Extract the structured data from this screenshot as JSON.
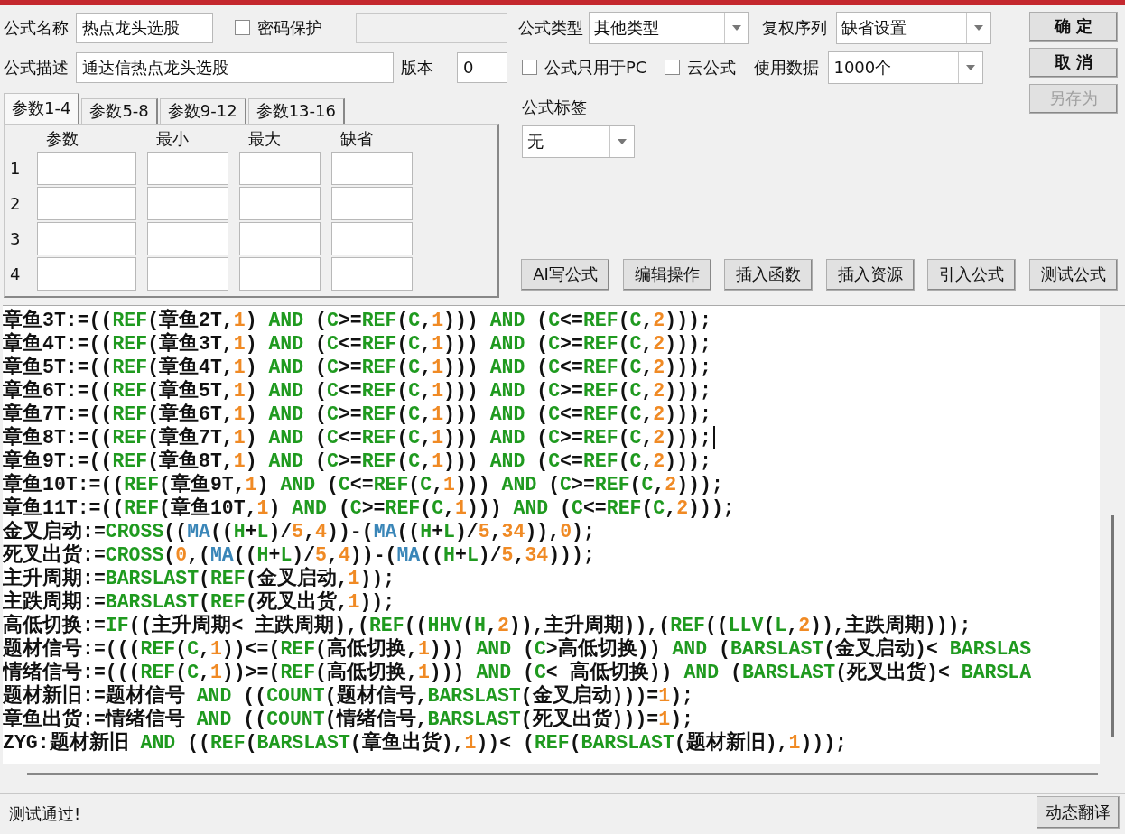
{
  "formula_name": {
    "label": "公式名称",
    "value": "热点龙头选股"
  },
  "password_protect": {
    "label": "密码保护",
    "checked": false
  },
  "password_field": {
    "disabled": true
  },
  "description": {
    "label": "公式描述",
    "value": "通达信热点龙头选股"
  },
  "version": {
    "label": "版本",
    "value": "0"
  },
  "param_tabs": [
    {
      "label": "参数1-4",
      "selected": true
    },
    {
      "label": "参数5-8",
      "selected": false
    },
    {
      "label": "参数9-12",
      "selected": false
    },
    {
      "label": "参数13-16",
      "selected": false
    }
  ],
  "param_table": {
    "columns": [
      "参数",
      "最小",
      "最大",
      "缺省"
    ],
    "rows": [
      "1",
      "2",
      "3",
      "4"
    ]
  },
  "formula_type": {
    "label": "公式类型",
    "value": "其他类型"
  },
  "adjust_series": {
    "label": "复权序列",
    "value": "缺省设置"
  },
  "pc_only": {
    "label": "公式只用于PC",
    "checked": false
  },
  "cloud": {
    "label": "云公式",
    "checked": false
  },
  "data_count": {
    "label": "使用数据",
    "value": "1000个"
  },
  "formula_tag": {
    "label": "公式标签",
    "value": "无"
  },
  "dialog_buttons": [
    {
      "label": "确 定",
      "disabled": false
    },
    {
      "label": "取 消",
      "disabled": false
    },
    {
      "label": "另存为",
      "disabled": true
    }
  ],
  "tool_buttons": [
    "AI写公式",
    "编辑操作",
    "插入函数",
    "插入资源",
    "引入公式",
    "测试公式"
  ],
  "code_lines": [
    {
      "cursor": false,
      "tokens": [
        {
          "kind": "text",
          "text": "章鱼3T:=(("
        },
        {
          "kind": "func",
          "text": "REF"
        },
        {
          "kind": "text",
          "text": "(章鱼2T,"
        },
        {
          "kind": "num",
          "text": "1"
        },
        {
          "kind": "text",
          "text": ") "
        },
        {
          "kind": "func",
          "text": "AND"
        },
        {
          "kind": "text",
          "text": " ("
        },
        {
          "kind": "func",
          "text": "C"
        },
        {
          "kind": "text",
          "text": ">="
        },
        {
          "kind": "func",
          "text": "REF"
        },
        {
          "kind": "text",
          "text": "("
        },
        {
          "kind": "func",
          "text": "C"
        },
        {
          "kind": "text",
          "text": ","
        },
        {
          "kind": "num",
          "text": "1"
        },
        {
          "kind": "text",
          "text": "))) "
        },
        {
          "kind": "func",
          "text": "AND"
        },
        {
          "kind": "text",
          "text": " ("
        },
        {
          "kind": "func",
          "text": "C"
        },
        {
          "kind": "text",
          "text": "<="
        },
        {
          "kind": "func",
          "text": "REF"
        },
        {
          "kind": "text",
          "text": "("
        },
        {
          "kind": "func",
          "text": "C"
        },
        {
          "kind": "text",
          "text": ","
        },
        {
          "kind": "num",
          "text": "2"
        },
        {
          "kind": "text",
          "text": ")));"
        }
      ]
    },
    {
      "cursor": false,
      "tokens": [
        {
          "kind": "text",
          "text": "章鱼4T:=(("
        },
        {
          "kind": "func",
          "text": "REF"
        },
        {
          "kind": "text",
          "text": "(章鱼3T,"
        },
        {
          "kind": "num",
          "text": "1"
        },
        {
          "kind": "text",
          "text": ") "
        },
        {
          "kind": "func",
          "text": "AND"
        },
        {
          "kind": "text",
          "text": " ("
        },
        {
          "kind": "func",
          "text": "C"
        },
        {
          "kind": "text",
          "text": "<="
        },
        {
          "kind": "func",
          "text": "REF"
        },
        {
          "kind": "text",
          "text": "("
        },
        {
          "kind": "func",
          "text": "C"
        },
        {
          "kind": "text",
          "text": ","
        },
        {
          "kind": "num",
          "text": "1"
        },
        {
          "kind": "text",
          "text": "))) "
        },
        {
          "kind": "func",
          "text": "AND"
        },
        {
          "kind": "text",
          "text": " ("
        },
        {
          "kind": "func",
          "text": "C"
        },
        {
          "kind": "text",
          "text": ">="
        },
        {
          "kind": "func",
          "text": "REF"
        },
        {
          "kind": "text",
          "text": "("
        },
        {
          "kind": "func",
          "text": "C"
        },
        {
          "kind": "text",
          "text": ","
        },
        {
          "kind": "num",
          "text": "2"
        },
        {
          "kind": "text",
          "text": ")));"
        }
      ]
    },
    {
      "cursor": false,
      "tokens": [
        {
          "kind": "text",
          "text": "章鱼5T:=(("
        },
        {
          "kind": "func",
          "text": "REF"
        },
        {
          "kind": "text",
          "text": "(章鱼4T,"
        },
        {
          "kind": "num",
          "text": "1"
        },
        {
          "kind": "text",
          "text": ") "
        },
        {
          "kind": "func",
          "text": "AND"
        },
        {
          "kind": "text",
          "text": " ("
        },
        {
          "kind": "func",
          "text": "C"
        },
        {
          "kind": "text",
          "text": ">="
        },
        {
          "kind": "func",
          "text": "REF"
        },
        {
          "kind": "text",
          "text": "("
        },
        {
          "kind": "func",
          "text": "C"
        },
        {
          "kind": "text",
          "text": ","
        },
        {
          "kind": "num",
          "text": "1"
        },
        {
          "kind": "text",
          "text": "))) "
        },
        {
          "kind": "func",
          "text": "AND"
        },
        {
          "kind": "text",
          "text": " ("
        },
        {
          "kind": "func",
          "text": "C"
        },
        {
          "kind": "text",
          "text": "<="
        },
        {
          "kind": "func",
          "text": "REF"
        },
        {
          "kind": "text",
          "text": "("
        },
        {
          "kind": "func",
          "text": "C"
        },
        {
          "kind": "text",
          "text": ","
        },
        {
          "kind": "num",
          "text": "2"
        },
        {
          "kind": "text",
          "text": ")));"
        }
      ]
    },
    {
      "cursor": false,
      "tokens": [
        {
          "kind": "text",
          "text": "章鱼6T:=(("
        },
        {
          "kind": "func",
          "text": "REF"
        },
        {
          "kind": "text",
          "text": "(章鱼5T,"
        },
        {
          "kind": "num",
          "text": "1"
        },
        {
          "kind": "text",
          "text": ") "
        },
        {
          "kind": "func",
          "text": "AND"
        },
        {
          "kind": "text",
          "text": " ("
        },
        {
          "kind": "func",
          "text": "C"
        },
        {
          "kind": "text",
          "text": "<="
        },
        {
          "kind": "func",
          "text": "REF"
        },
        {
          "kind": "text",
          "text": "("
        },
        {
          "kind": "func",
          "text": "C"
        },
        {
          "kind": "text",
          "text": ","
        },
        {
          "kind": "num",
          "text": "1"
        },
        {
          "kind": "text",
          "text": "))) "
        },
        {
          "kind": "func",
          "text": "AND"
        },
        {
          "kind": "text",
          "text": " ("
        },
        {
          "kind": "func",
          "text": "C"
        },
        {
          "kind": "text",
          "text": ">="
        },
        {
          "kind": "func",
          "text": "REF"
        },
        {
          "kind": "text",
          "text": "("
        },
        {
          "kind": "func",
          "text": "C"
        },
        {
          "kind": "text",
          "text": ","
        },
        {
          "kind": "num",
          "text": "2"
        },
        {
          "kind": "text",
          "text": ")));"
        }
      ]
    },
    {
      "cursor": false,
      "tokens": [
        {
          "kind": "text",
          "text": "章鱼7T:=(("
        },
        {
          "kind": "func",
          "text": "REF"
        },
        {
          "kind": "text",
          "text": "(章鱼6T,"
        },
        {
          "kind": "num",
          "text": "1"
        },
        {
          "kind": "text",
          "text": ") "
        },
        {
          "kind": "func",
          "text": "AND"
        },
        {
          "kind": "text",
          "text": " ("
        },
        {
          "kind": "func",
          "text": "C"
        },
        {
          "kind": "text",
          "text": ">="
        },
        {
          "kind": "func",
          "text": "REF"
        },
        {
          "kind": "text",
          "text": "("
        },
        {
          "kind": "func",
          "text": "C"
        },
        {
          "kind": "text",
          "text": ","
        },
        {
          "kind": "num",
          "text": "1"
        },
        {
          "kind": "text",
          "text": "))) "
        },
        {
          "kind": "func",
          "text": "AND"
        },
        {
          "kind": "text",
          "text": " ("
        },
        {
          "kind": "func",
          "text": "C"
        },
        {
          "kind": "text",
          "text": "<="
        },
        {
          "kind": "func",
          "text": "REF"
        },
        {
          "kind": "text",
          "text": "("
        },
        {
          "kind": "func",
          "text": "C"
        },
        {
          "kind": "text",
          "text": ","
        },
        {
          "kind": "num",
          "text": "2"
        },
        {
          "kind": "text",
          "text": ")));"
        }
      ]
    },
    {
      "cursor": true,
      "tokens": [
        {
          "kind": "text",
          "text": "章鱼8T:=(("
        },
        {
          "kind": "func",
          "text": "REF"
        },
        {
          "kind": "text",
          "text": "(章鱼7T,"
        },
        {
          "kind": "num",
          "text": "1"
        },
        {
          "kind": "text",
          "text": ") "
        },
        {
          "kind": "func",
          "text": "AND"
        },
        {
          "kind": "text",
          "text": " ("
        },
        {
          "kind": "func",
          "text": "C"
        },
        {
          "kind": "text",
          "text": "<="
        },
        {
          "kind": "func",
          "text": "REF"
        },
        {
          "kind": "text",
          "text": "("
        },
        {
          "kind": "func",
          "text": "C"
        },
        {
          "kind": "text",
          "text": ","
        },
        {
          "kind": "num",
          "text": "1"
        },
        {
          "kind": "text",
          "text": "))) "
        },
        {
          "kind": "func",
          "text": "AND"
        },
        {
          "kind": "text",
          "text": " ("
        },
        {
          "kind": "func",
          "text": "C"
        },
        {
          "kind": "text",
          "text": ">="
        },
        {
          "kind": "func",
          "text": "REF"
        },
        {
          "kind": "text",
          "text": "("
        },
        {
          "kind": "func",
          "text": "C"
        },
        {
          "kind": "text",
          "text": ","
        },
        {
          "kind": "num",
          "text": "2"
        },
        {
          "kind": "text",
          "text": ")));"
        }
      ]
    },
    {
      "cursor": false,
      "tokens": [
        {
          "kind": "text",
          "text": "章鱼9T:=(("
        },
        {
          "kind": "func",
          "text": "REF"
        },
        {
          "kind": "text",
          "text": "(章鱼8T,"
        },
        {
          "kind": "num",
          "text": "1"
        },
        {
          "kind": "text",
          "text": ") "
        },
        {
          "kind": "func",
          "text": "AND"
        },
        {
          "kind": "text",
          "text": " ("
        },
        {
          "kind": "func",
          "text": "C"
        },
        {
          "kind": "text",
          "text": ">="
        },
        {
          "kind": "func",
          "text": "REF"
        },
        {
          "kind": "text",
          "text": "("
        },
        {
          "kind": "func",
          "text": "C"
        },
        {
          "kind": "text",
          "text": ","
        },
        {
          "kind": "num",
          "text": "1"
        },
        {
          "kind": "text",
          "text": "))) "
        },
        {
          "kind": "func",
          "text": "AND"
        },
        {
          "kind": "text",
          "text": " ("
        },
        {
          "kind": "func",
          "text": "C"
        },
        {
          "kind": "text",
          "text": "<="
        },
        {
          "kind": "func",
          "text": "REF"
        },
        {
          "kind": "text",
          "text": "("
        },
        {
          "kind": "func",
          "text": "C"
        },
        {
          "kind": "text",
          "text": ","
        },
        {
          "kind": "num",
          "text": "2"
        },
        {
          "kind": "text",
          "text": ")));"
        }
      ]
    },
    {
      "cursor": false,
      "tokens": [
        {
          "kind": "text",
          "text": "章鱼10T:=(("
        },
        {
          "kind": "func",
          "text": "REF"
        },
        {
          "kind": "text",
          "text": "(章鱼9T,"
        },
        {
          "kind": "num",
          "text": "1"
        },
        {
          "kind": "text",
          "text": ") "
        },
        {
          "kind": "func",
          "text": "AND"
        },
        {
          "kind": "text",
          "text": " ("
        },
        {
          "kind": "func",
          "text": "C"
        },
        {
          "kind": "text",
          "text": "<="
        },
        {
          "kind": "func",
          "text": "REF"
        },
        {
          "kind": "text",
          "text": "("
        },
        {
          "kind": "func",
          "text": "C"
        },
        {
          "kind": "text",
          "text": ","
        },
        {
          "kind": "num",
          "text": "1"
        },
        {
          "kind": "text",
          "text": "))) "
        },
        {
          "kind": "func",
          "text": "AND"
        },
        {
          "kind": "text",
          "text": " ("
        },
        {
          "kind": "func",
          "text": "C"
        },
        {
          "kind": "text",
          "text": ">="
        },
        {
          "kind": "func",
          "text": "REF"
        },
        {
          "kind": "text",
          "text": "("
        },
        {
          "kind": "func",
          "text": "C"
        },
        {
          "kind": "text",
          "text": ","
        },
        {
          "kind": "num",
          "text": "2"
        },
        {
          "kind": "text",
          "text": ")));"
        }
      ]
    },
    {
      "cursor": false,
      "tokens": [
        {
          "kind": "text",
          "text": "章鱼11T:=(("
        },
        {
          "kind": "func",
          "text": "REF"
        },
        {
          "kind": "text",
          "text": "(章鱼10T,"
        },
        {
          "kind": "num",
          "text": "1"
        },
        {
          "kind": "text",
          "text": ") "
        },
        {
          "kind": "func",
          "text": "AND"
        },
        {
          "kind": "text",
          "text": " ("
        },
        {
          "kind": "func",
          "text": "C"
        },
        {
          "kind": "text",
          "text": ">="
        },
        {
          "kind": "func",
          "text": "REF"
        },
        {
          "kind": "text",
          "text": "("
        },
        {
          "kind": "func",
          "text": "C"
        },
        {
          "kind": "text",
          "text": ","
        },
        {
          "kind": "num",
          "text": "1"
        },
        {
          "kind": "text",
          "text": "))) "
        },
        {
          "kind": "func",
          "text": "AND"
        },
        {
          "kind": "text",
          "text": " ("
        },
        {
          "kind": "func",
          "text": "C"
        },
        {
          "kind": "text",
          "text": "<="
        },
        {
          "kind": "func",
          "text": "REF"
        },
        {
          "kind": "text",
          "text": "("
        },
        {
          "kind": "func",
          "text": "C"
        },
        {
          "kind": "text",
          "text": ","
        },
        {
          "kind": "num",
          "text": "2"
        },
        {
          "kind": "text",
          "text": ")));"
        }
      ]
    },
    {
      "cursor": false,
      "tokens": [
        {
          "kind": "text",
          "text": "金叉启动:="
        },
        {
          "kind": "func",
          "text": "CROSS"
        },
        {
          "kind": "text",
          "text": "(("
        },
        {
          "kind": "indicator",
          "text": "MA"
        },
        {
          "kind": "text",
          "text": "(("
        },
        {
          "kind": "func",
          "text": "H"
        },
        {
          "kind": "text",
          "text": "+"
        },
        {
          "kind": "func",
          "text": "L"
        },
        {
          "kind": "text",
          "text": ")/"
        },
        {
          "kind": "num",
          "text": "5"
        },
        {
          "kind": "text",
          "text": ","
        },
        {
          "kind": "num",
          "text": "4"
        },
        {
          "kind": "text",
          "text": "))-("
        },
        {
          "kind": "indicator",
          "text": "MA"
        },
        {
          "kind": "text",
          "text": "(("
        },
        {
          "kind": "func",
          "text": "H"
        },
        {
          "kind": "text",
          "text": "+"
        },
        {
          "kind": "func",
          "text": "L"
        },
        {
          "kind": "text",
          "text": ")/"
        },
        {
          "kind": "num",
          "text": "5"
        },
        {
          "kind": "text",
          "text": ","
        },
        {
          "kind": "num",
          "text": "34"
        },
        {
          "kind": "text",
          "text": ")),"
        },
        {
          "kind": "num",
          "text": "0"
        },
        {
          "kind": "text",
          "text": ");"
        }
      ]
    },
    {
      "cursor": false,
      "tokens": [
        {
          "kind": "text",
          "text": "死叉出货:="
        },
        {
          "kind": "func",
          "text": "CROSS"
        },
        {
          "kind": "text",
          "text": "("
        },
        {
          "kind": "num",
          "text": "0"
        },
        {
          "kind": "text",
          "text": ",("
        },
        {
          "kind": "indicator",
          "text": "MA"
        },
        {
          "kind": "text",
          "text": "(("
        },
        {
          "kind": "func",
          "text": "H"
        },
        {
          "kind": "text",
          "text": "+"
        },
        {
          "kind": "func",
          "text": "L"
        },
        {
          "kind": "text",
          "text": ")/"
        },
        {
          "kind": "num",
          "text": "5"
        },
        {
          "kind": "text",
          "text": ","
        },
        {
          "kind": "num",
          "text": "4"
        },
        {
          "kind": "text",
          "text": "))-("
        },
        {
          "kind": "indicator",
          "text": "MA"
        },
        {
          "kind": "text",
          "text": "(("
        },
        {
          "kind": "func",
          "text": "H"
        },
        {
          "kind": "text",
          "text": "+"
        },
        {
          "kind": "func",
          "text": "L"
        },
        {
          "kind": "text",
          "text": ")/"
        },
        {
          "kind": "num",
          "text": "5"
        },
        {
          "kind": "text",
          "text": ","
        },
        {
          "kind": "num",
          "text": "34"
        },
        {
          "kind": "text",
          "text": ")));"
        }
      ]
    },
    {
      "cursor": false,
      "tokens": [
        {
          "kind": "text",
          "text": "主升周期:="
        },
        {
          "kind": "func",
          "text": "BARSLAST"
        },
        {
          "kind": "text",
          "text": "("
        },
        {
          "kind": "func",
          "text": "REF"
        },
        {
          "kind": "text",
          "text": "(金叉启动,"
        },
        {
          "kind": "num",
          "text": "1"
        },
        {
          "kind": "text",
          "text": "));"
        }
      ]
    },
    {
      "cursor": false,
      "tokens": [
        {
          "kind": "text",
          "text": "主跌周期:="
        },
        {
          "kind": "func",
          "text": "BARSLAST"
        },
        {
          "kind": "text",
          "text": "("
        },
        {
          "kind": "func",
          "text": "REF"
        },
        {
          "kind": "text",
          "text": "(死叉出货,"
        },
        {
          "kind": "num",
          "text": "1"
        },
        {
          "kind": "text",
          "text": "));"
        }
      ]
    },
    {
      "cursor": false,
      "tokens": [
        {
          "kind": "text",
          "text": "高低切换:="
        },
        {
          "kind": "func",
          "text": "IF"
        },
        {
          "kind": "text",
          "text": "((主升周期< 主跌周期),("
        },
        {
          "kind": "func",
          "text": "REF"
        },
        {
          "kind": "text",
          "text": "(("
        },
        {
          "kind": "func",
          "text": "HHV"
        },
        {
          "kind": "text",
          "text": "("
        },
        {
          "kind": "func",
          "text": "H"
        },
        {
          "kind": "text",
          "text": ","
        },
        {
          "kind": "num",
          "text": "2"
        },
        {
          "kind": "text",
          "text": ")),主升周期)),("
        },
        {
          "kind": "func",
          "text": "REF"
        },
        {
          "kind": "text",
          "text": "(("
        },
        {
          "kind": "func",
          "text": "LLV"
        },
        {
          "kind": "text",
          "text": "("
        },
        {
          "kind": "func",
          "text": "L"
        },
        {
          "kind": "text",
          "text": ","
        },
        {
          "kind": "num",
          "text": "2"
        },
        {
          "kind": "text",
          "text": ")),主跌周期)));"
        }
      ]
    },
    {
      "cursor": false,
      "tokens": [
        {
          "kind": "text",
          "text": "题材信号:=((("
        },
        {
          "kind": "func",
          "text": "REF"
        },
        {
          "kind": "text",
          "text": "("
        },
        {
          "kind": "func",
          "text": "C"
        },
        {
          "kind": "text",
          "text": ","
        },
        {
          "kind": "num",
          "text": "1"
        },
        {
          "kind": "text",
          "text": "))<=("
        },
        {
          "kind": "func",
          "text": "REF"
        },
        {
          "kind": "text",
          "text": "(高低切换,"
        },
        {
          "kind": "num",
          "text": "1"
        },
        {
          "kind": "text",
          "text": "))) "
        },
        {
          "kind": "func",
          "text": "AND"
        },
        {
          "kind": "text",
          "text": " ("
        },
        {
          "kind": "func",
          "text": "C"
        },
        {
          "kind": "text",
          "text": ">高低切换)) "
        },
        {
          "kind": "func",
          "text": "AND"
        },
        {
          "kind": "text",
          "text": " ("
        },
        {
          "kind": "func",
          "text": "BARSLAST"
        },
        {
          "kind": "text",
          "text": "(金叉启动)< "
        },
        {
          "kind": "func",
          "text": "BARSLAS"
        }
      ]
    },
    {
      "cursor": false,
      "tokens": [
        {
          "kind": "text",
          "text": "情绪信号:=((("
        },
        {
          "kind": "func",
          "text": "REF"
        },
        {
          "kind": "text",
          "text": "("
        },
        {
          "kind": "func",
          "text": "C"
        },
        {
          "kind": "text",
          "text": ","
        },
        {
          "kind": "num",
          "text": "1"
        },
        {
          "kind": "text",
          "text": "))>=("
        },
        {
          "kind": "func",
          "text": "REF"
        },
        {
          "kind": "text",
          "text": "(高低切换,"
        },
        {
          "kind": "num",
          "text": "1"
        },
        {
          "kind": "text",
          "text": "))) "
        },
        {
          "kind": "func",
          "text": "AND"
        },
        {
          "kind": "text",
          "text": " ("
        },
        {
          "kind": "func",
          "text": "C"
        },
        {
          "kind": "text",
          "text": "< 高低切换)) "
        },
        {
          "kind": "func",
          "text": "AND"
        },
        {
          "kind": "text",
          "text": " ("
        },
        {
          "kind": "func",
          "text": "BARSLAST"
        },
        {
          "kind": "text",
          "text": "(死叉出货)< "
        },
        {
          "kind": "func",
          "text": "BARSLA"
        }
      ]
    },
    {
      "cursor": false,
      "tokens": [
        {
          "kind": "text",
          "text": "题材新旧:=题材信号 "
        },
        {
          "kind": "func",
          "text": "AND"
        },
        {
          "kind": "text",
          "text": " (("
        },
        {
          "kind": "func",
          "text": "COUNT"
        },
        {
          "kind": "text",
          "text": "(题材信号,"
        },
        {
          "kind": "func",
          "text": "BARSLAST"
        },
        {
          "kind": "text",
          "text": "(金叉启动)))="
        },
        {
          "kind": "num",
          "text": "1"
        },
        {
          "kind": "text",
          "text": ");"
        }
      ]
    },
    {
      "cursor": false,
      "tokens": [
        {
          "kind": "text",
          "text": "章鱼出货:=情绪信号 "
        },
        {
          "kind": "func",
          "text": "AND"
        },
        {
          "kind": "text",
          "text": " (("
        },
        {
          "kind": "func",
          "text": "COUNT"
        },
        {
          "kind": "text",
          "text": "(情绪信号,"
        },
        {
          "kind": "func",
          "text": "BARSLAST"
        },
        {
          "kind": "text",
          "text": "(死叉出货)))="
        },
        {
          "kind": "num",
          "text": "1"
        },
        {
          "kind": "text",
          "text": ");"
        }
      ]
    },
    {
      "cursor": false,
      "tokens": [
        {
          "kind": "text",
          "text": "ZYG:题材新旧 "
        },
        {
          "kind": "func",
          "text": "AND"
        },
        {
          "kind": "text",
          "text": " (("
        },
        {
          "kind": "func",
          "text": "REF"
        },
        {
          "kind": "text",
          "text": "("
        },
        {
          "kind": "func",
          "text": "BARSLAST"
        },
        {
          "kind": "text",
          "text": "(章鱼出货),"
        },
        {
          "kind": "num",
          "text": "1"
        },
        {
          "kind": "text",
          "text": "))< ("
        },
        {
          "kind": "func",
          "text": "REF"
        },
        {
          "kind": "text",
          "text": "("
        },
        {
          "kind": "func",
          "text": "BARSLAST"
        },
        {
          "kind": "text",
          "text": "(题材新旧),"
        },
        {
          "kind": "num",
          "text": "1"
        },
        {
          "kind": "text",
          "text": ")));"
        }
      ]
    }
  ],
  "status": {
    "message": "测试通过!",
    "button": "动态翻译"
  }
}
